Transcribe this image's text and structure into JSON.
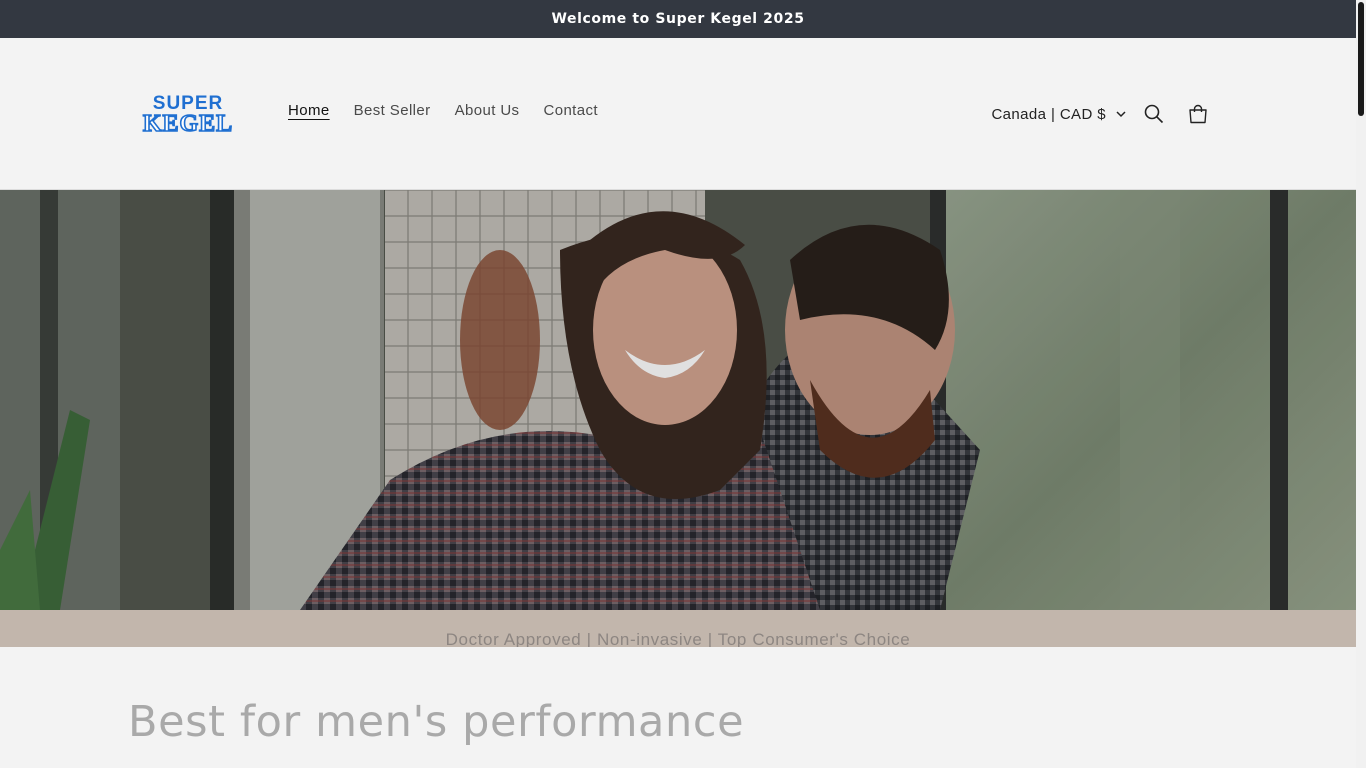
{
  "announcement": {
    "text": "Welcome to Super Kegel 2025"
  },
  "header": {
    "logo_text_top": "SUPER",
    "logo_text_bottom": "KEGEL",
    "nav": [
      {
        "label": "Home",
        "active": true
      },
      {
        "label": "Best Seller",
        "active": false
      },
      {
        "label": "About Us",
        "active": false
      },
      {
        "label": "Contact",
        "active": false
      }
    ],
    "currency_label": "Canada | CAD $",
    "icons": [
      "chevron-down-icon",
      "search-icon",
      "cart-icon"
    ]
  },
  "hero": {
    "image_alt": "Laughing couple indoors by a window"
  },
  "tagline": {
    "text": "Doctor Approved | Non-invasive | Top Consumer's Choice"
  },
  "section": {
    "title": "Best for men's performance"
  },
  "colors": {
    "announcement_bg": "#333841",
    "logo_blue": "#1f6fd1",
    "tagline_bg": "#c2b6ac",
    "page_bg": "#f3f3f3"
  }
}
